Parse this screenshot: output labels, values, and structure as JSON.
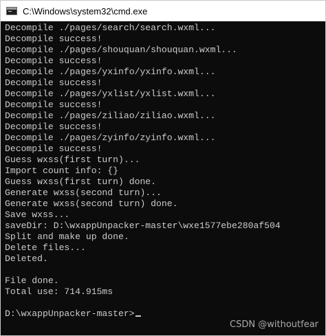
{
  "window": {
    "title": "C:\\Windows\\system32\\cmd.exe",
    "icon": "cmd-icon"
  },
  "console": {
    "lines": [
      "Decompile ./pages/search/search.wxml...",
      "Decompile success!",
      "Decompile ./pages/shouquan/shouquan.wxml...",
      "Decompile success!",
      "Decompile ./pages/yxinfo/yxinfo.wxml...",
      "Decompile success!",
      "Decompile ./pages/yxlist/yxlist.wxml...",
      "Decompile success!",
      "Decompile ./pages/ziliao/ziliao.wxml...",
      "Decompile success!",
      "Decompile ./pages/zyinfo/zyinfo.wxml...",
      "Decompile success!",
      "Guess wxss(first turn)...",
      "Import count info: {}",
      "Guess wxss(first turn) done.",
      "Generate wxss(second turn)...",
      "Generate wxss(second turn) done.",
      "Save wxss...",
      "saveDir: D:\\wxappUnpacker-master\\wxe1577ebe280af504",
      "Split and make up done.",
      "Delete files...",
      "Deleted.",
      "",
      "File done.",
      "Total use: 714.915ms",
      "",
      "D:\\wxappUnpacker-master>"
    ]
  },
  "watermark": "CSDN @withoutfear",
  "colors": {
    "console_background": "#0c0c0c",
    "console_text": "#cccccc",
    "titlebar_background": "#ffffff"
  }
}
